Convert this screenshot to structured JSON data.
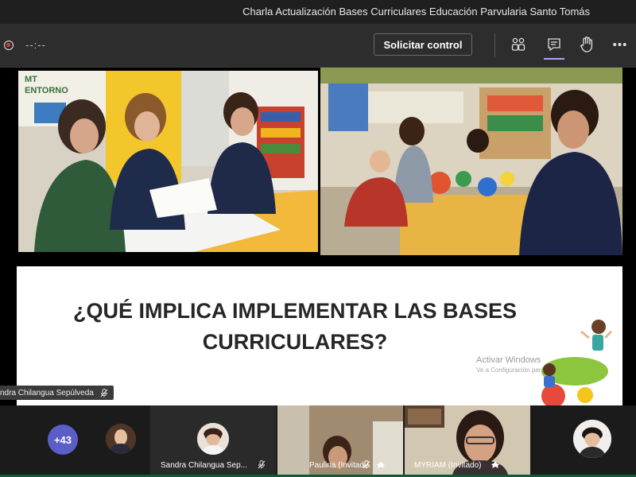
{
  "window": {
    "title": "Charla Actualización Bases Curriculares Educación Parvularia Santo Tomás"
  },
  "toolbar": {
    "timer": "--:--",
    "control_label": "Solicitar control",
    "icons": [
      "record-icon",
      "participants-icon",
      "chat-icon",
      "raise-hand-icon",
      "more-icon"
    ],
    "more_label": "•••"
  },
  "slide": {
    "photo1_sign": "MT\nENTORNO",
    "heading": "¿QUÉ IMPLICA IMPLEMENTAR LAS BASES CURRICULARES?",
    "watermark_title": "Activar Windows",
    "watermark_sub": "Ve a Configuración para activar Windows."
  },
  "presenter_tag": "ndra Chilangua Sepúlveda",
  "participants": {
    "overflow_count": "+43",
    "tiles": [
      {
        "name": "Sandra Chilangua Sep..."
      },
      {
        "name": "Paulina (Invitad..."
      },
      {
        "name": "MYRIAM (Invitado)"
      }
    ]
  },
  "colors": {
    "accent": "#5c5ec8",
    "titlebar": "#1f1f1f",
    "toolbar": "#2d2d2d",
    "record": "#d83b3b"
  }
}
